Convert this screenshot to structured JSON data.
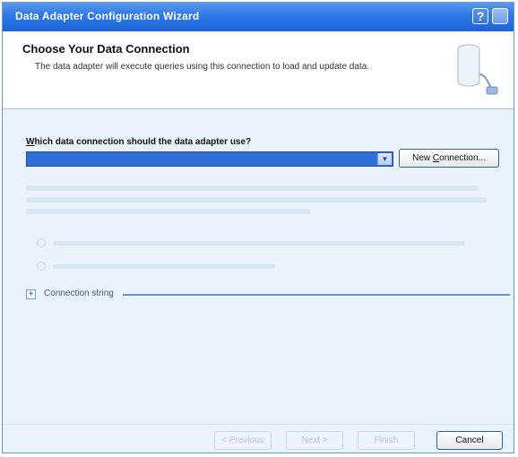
{
  "window": {
    "title": "Data Adapter Configuration Wizard",
    "help_glyph": "?"
  },
  "header": {
    "title": "Choose Your Data Connection",
    "description": "The data adapter will execute queries using this connection to load and update data."
  },
  "connection": {
    "question_prefix": "W",
    "question_rest": "hich data connection should the data adapter use?",
    "selected_value": "",
    "new_connection_prefix": "New ",
    "new_connection_accel": "C",
    "new_connection_rest": "onnection..."
  },
  "expander": {
    "label": "Connection string"
  },
  "footer": {
    "previous_label": "< Previous",
    "next_label": "Next >",
    "finish_label": "Finish",
    "cancel_label": "Cancel"
  },
  "colors": {
    "titlebar": "#2d78e6",
    "selection": "#2f6fd6",
    "window_bg": "#eaf3fb"
  },
  "icons": [
    "help-icon",
    "close-icon",
    "database-connection-icon",
    "dropdown-arrow-icon",
    "expand-plus-icon"
  ]
}
